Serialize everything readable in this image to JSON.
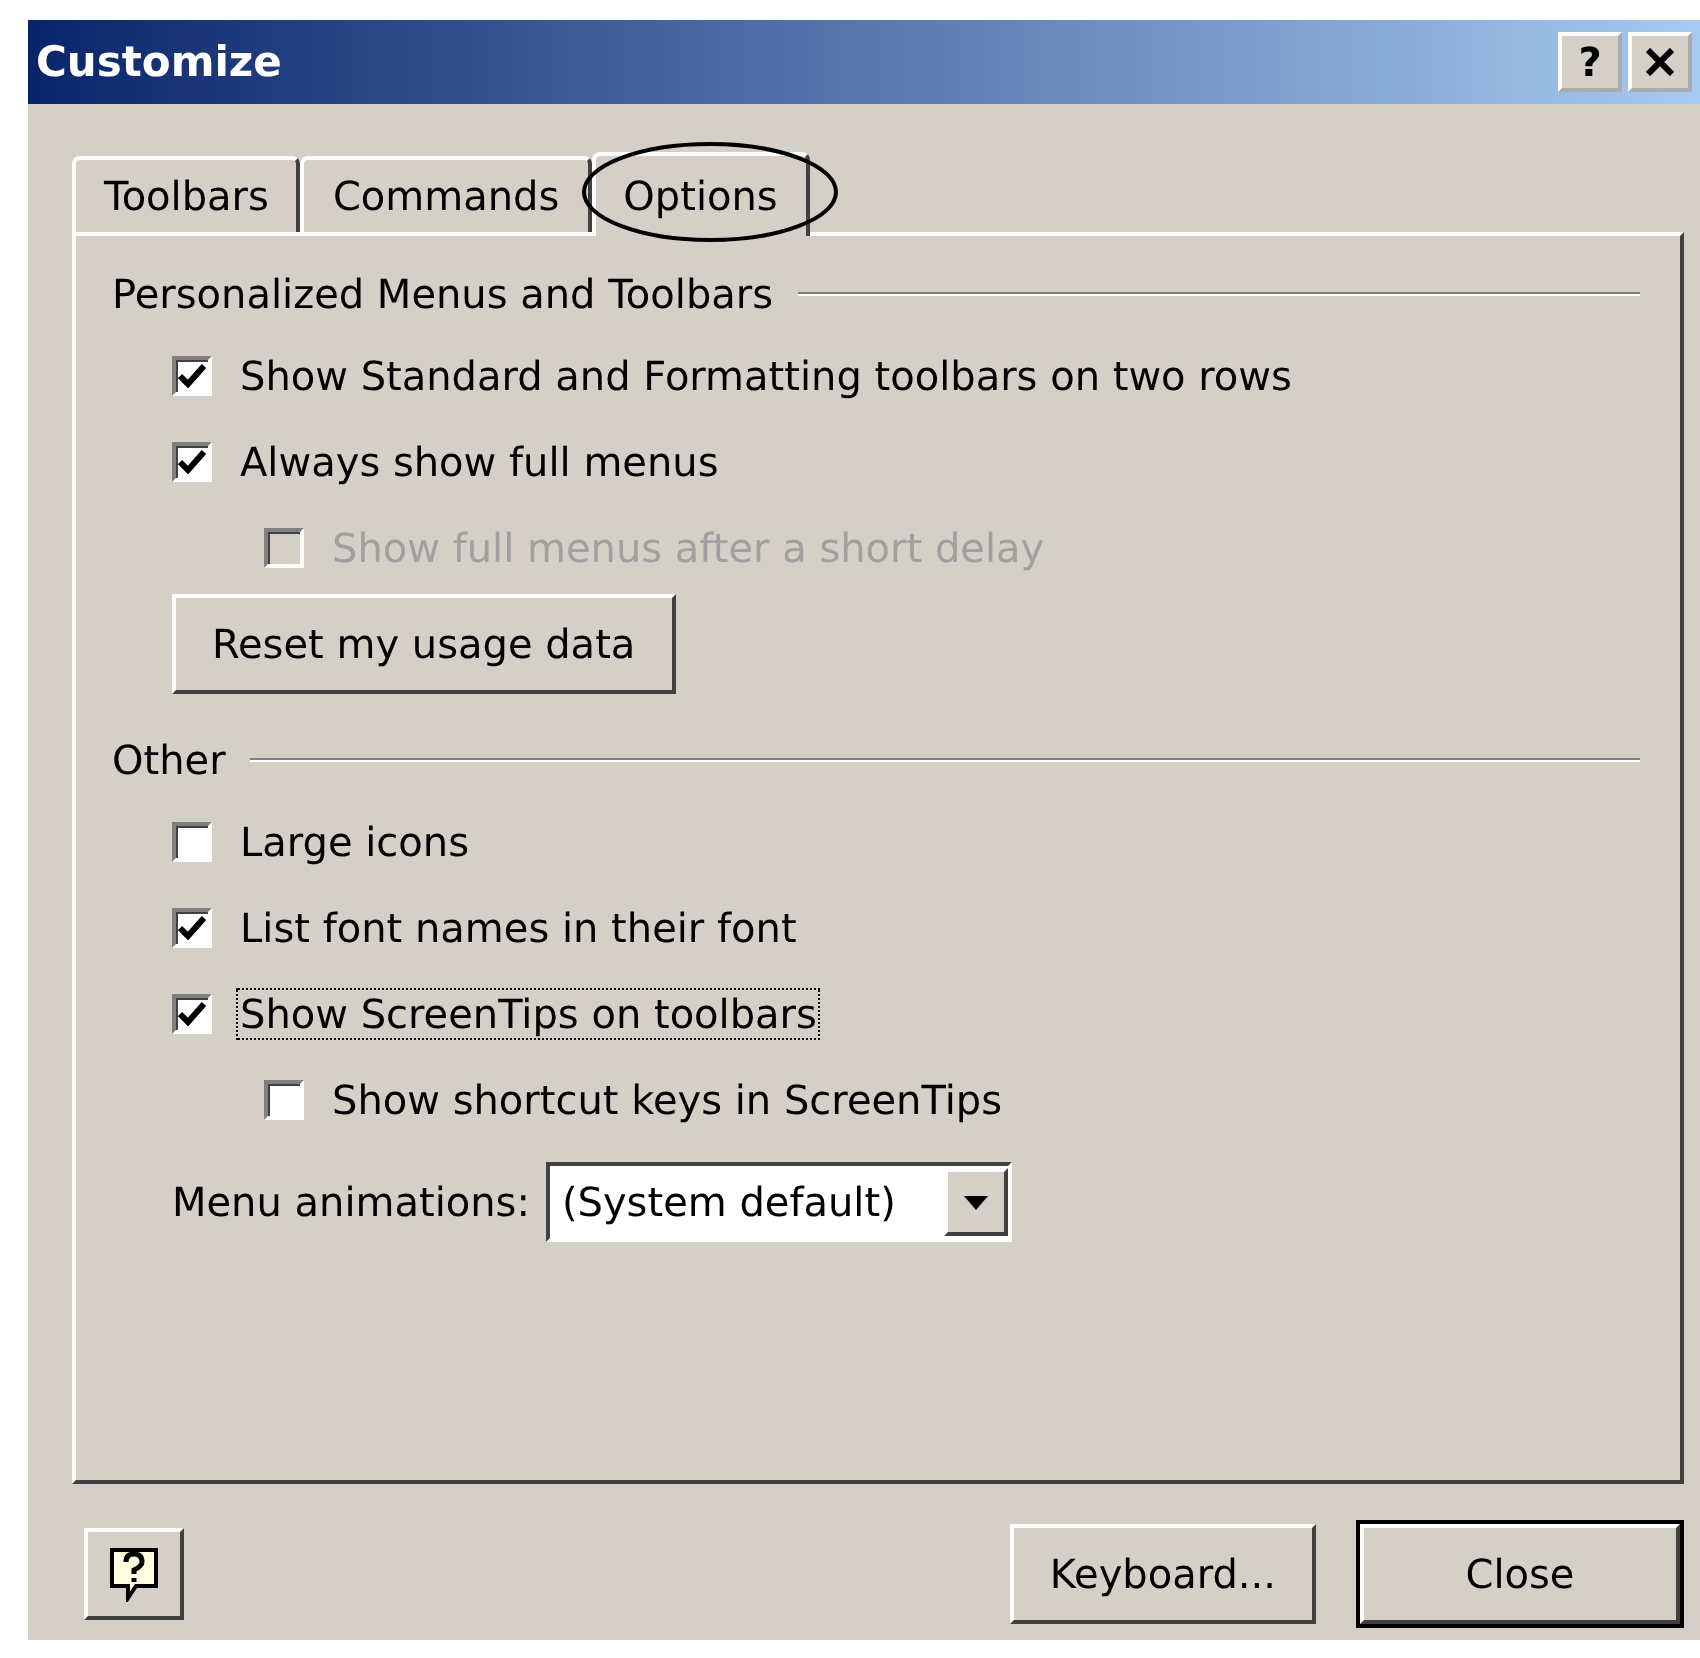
{
  "window": {
    "title": "Customize",
    "help_button": "?"
  },
  "tabs": [
    {
      "label": "Toolbars",
      "selected": false
    },
    {
      "label": "Commands",
      "selected": false
    },
    {
      "label": "Options",
      "selected": true
    }
  ],
  "sections": [
    {
      "title": "Personalized Menus and Toolbars",
      "items": [
        {
          "kind": "checkbox",
          "label": "Show Standard and Formatting toolbars on two rows",
          "checked": true,
          "disabled": false,
          "focused": false
        },
        {
          "kind": "checkbox",
          "label": "Always show full menus",
          "checked": true,
          "disabled": false,
          "focused": false,
          "children": [
            {
              "kind": "checkbox",
              "label": "Show full menus after a short delay",
              "checked": false,
              "disabled": true,
              "focused": false
            }
          ]
        },
        {
          "kind": "button",
          "label": "Reset my usage data"
        }
      ]
    },
    {
      "title": "Other",
      "items": [
        {
          "kind": "checkbox",
          "label": "Large icons",
          "checked": false,
          "disabled": false,
          "focused": false
        },
        {
          "kind": "checkbox",
          "label": "List font names in their font",
          "checked": true,
          "disabled": false,
          "focused": false
        },
        {
          "kind": "checkbox",
          "label": "Show ScreenTips on toolbars",
          "checked": true,
          "disabled": false,
          "focused": true,
          "children": [
            {
              "kind": "checkbox",
              "label": "Show shortcut keys in ScreenTips",
              "checked": false,
              "disabled": false,
              "focused": false
            }
          ]
        },
        {
          "kind": "dropdown",
          "label": "Menu animations:",
          "value": "(System default)"
        }
      ]
    }
  ],
  "footer": {
    "buttons": [
      {
        "label": "Keyboard...",
        "default": false
      },
      {
        "label": "Close",
        "default": true
      }
    ]
  }
}
